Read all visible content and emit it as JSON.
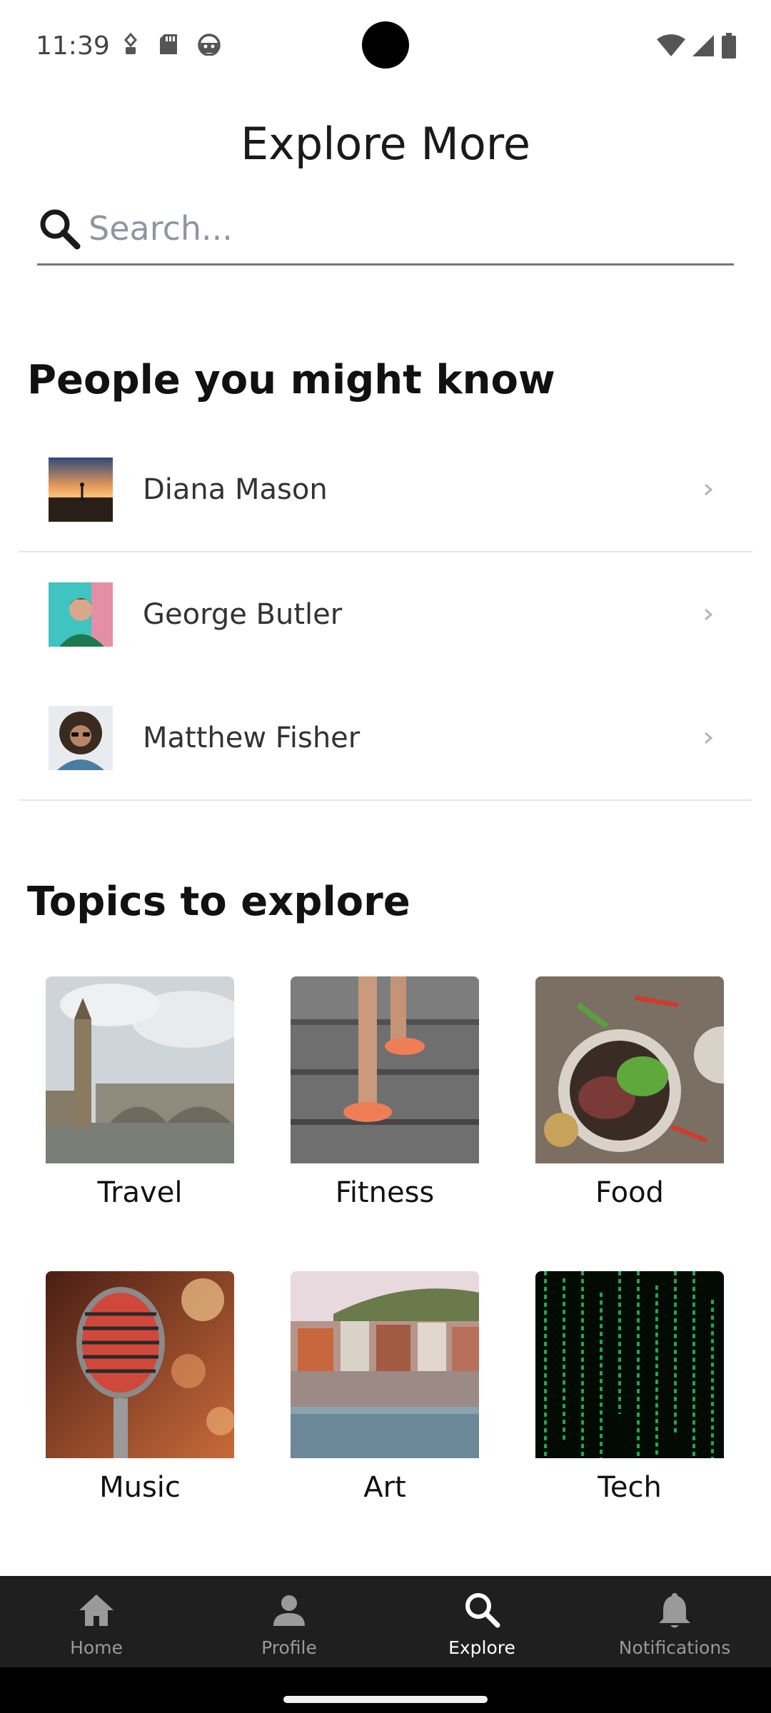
{
  "status_bar": {
    "time": "11:39",
    "left_icons": [
      "usb-debug-icon",
      "sd-card-icon",
      "android-icon"
    ],
    "right_icons": [
      "wifi-icon",
      "cell-signal-icon",
      "battery-icon"
    ]
  },
  "header": {
    "title": "Explore More"
  },
  "search": {
    "placeholder": "Search...",
    "value": ""
  },
  "people_section": {
    "heading": "People you might know",
    "people": [
      {
        "name": "Diana Mason"
      },
      {
        "name": "George Butler"
      },
      {
        "name": "Matthew Fisher"
      }
    ]
  },
  "topics_section": {
    "heading": "Topics to explore",
    "topics": [
      {
        "label": "Travel"
      },
      {
        "label": "Fitness"
      },
      {
        "label": "Food"
      },
      {
        "label": "Music"
      },
      {
        "label": "Art"
      },
      {
        "label": "Tech"
      }
    ]
  },
  "bottom_nav": {
    "items": [
      {
        "label": "Home",
        "icon": "home-icon",
        "active": false
      },
      {
        "label": "Profile",
        "icon": "person-icon",
        "active": false
      },
      {
        "label": "Explore",
        "icon": "search-icon",
        "active": true
      },
      {
        "label": "Notifications",
        "icon": "bell-icon",
        "active": false
      }
    ]
  },
  "colors": {
    "nav_background": "#1f1f1f",
    "nav_active": "#ffffff",
    "nav_inactive": "#9a9a9a",
    "search_underline": "#6e7684"
  }
}
